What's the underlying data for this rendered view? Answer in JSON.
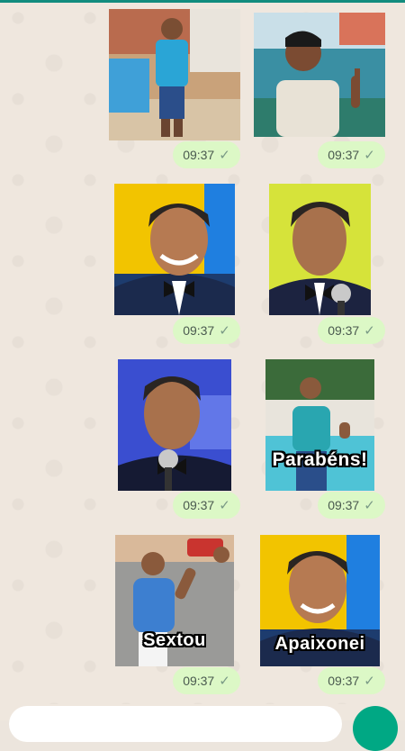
{
  "messages": [
    {
      "time": "09:37",
      "status": "read-check-icon"
    },
    {
      "time": "09:37",
      "status": "read-check-icon"
    },
    {
      "time": "09:37",
      "status": "read-check-icon"
    },
    {
      "time": "09:37",
      "status": "read-check-icon"
    },
    {
      "time": "09:37",
      "status": "read-check-icon"
    },
    {
      "time": "09:37",
      "status": "read-check-icon"
    },
    {
      "time": "09:37",
      "status": "read-check-icon"
    },
    {
      "time": "09:37",
      "status": "read-check-icon"
    }
  ],
  "captions": {
    "sticker6": "Parabéns!",
    "sticker7": "Sextou",
    "sticker8": "Apaixonei"
  },
  "tick_glyph": "✓",
  "colors": {
    "chat_background": "#efe7de",
    "outgoing_bubble": "#dcf8c6",
    "accent": "#00a884",
    "header": "#128c7e"
  }
}
